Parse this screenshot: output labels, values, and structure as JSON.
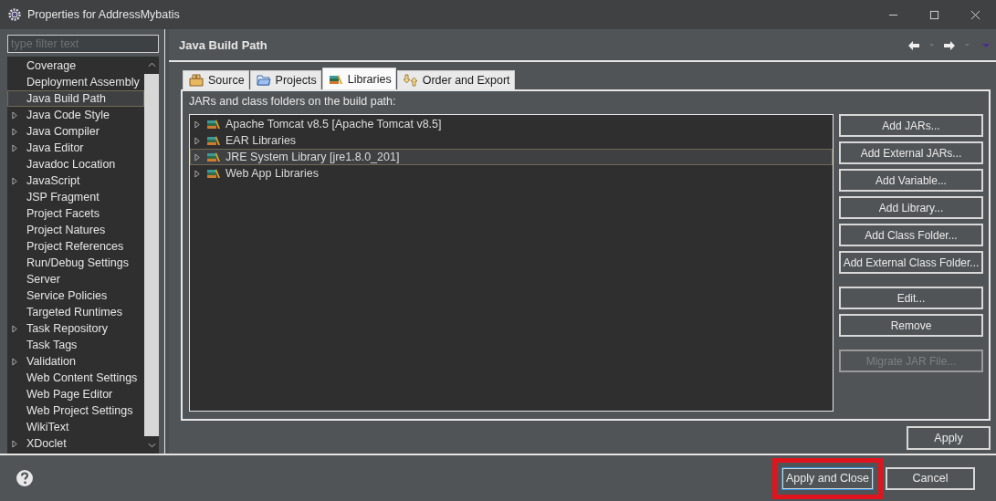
{
  "window": {
    "title": "Properties for AddressMybatis"
  },
  "filter": {
    "placeholder": "type filter text"
  },
  "sidebar": {
    "items": [
      {
        "label": "Coverage",
        "expandable": false,
        "selected": false
      },
      {
        "label": "Deployment Assembly",
        "expandable": false,
        "selected": false
      },
      {
        "label": "Java Build Path",
        "expandable": false,
        "selected": true
      },
      {
        "label": "Java Code Style",
        "expandable": true,
        "selected": false
      },
      {
        "label": "Java Compiler",
        "expandable": true,
        "selected": false
      },
      {
        "label": "Java Editor",
        "expandable": true,
        "selected": false
      },
      {
        "label": "Javadoc Location",
        "expandable": false,
        "selected": false
      },
      {
        "label": "JavaScript",
        "expandable": true,
        "selected": false
      },
      {
        "label": "JSP Fragment",
        "expandable": false,
        "selected": false
      },
      {
        "label": "Project Facets",
        "expandable": false,
        "selected": false
      },
      {
        "label": "Project Natures",
        "expandable": false,
        "selected": false
      },
      {
        "label": "Project References",
        "expandable": false,
        "selected": false
      },
      {
        "label": "Run/Debug Settings",
        "expandable": false,
        "selected": false
      },
      {
        "label": "Server",
        "expandable": false,
        "selected": false
      },
      {
        "label": "Service Policies",
        "expandable": false,
        "selected": false
      },
      {
        "label": "Targeted Runtimes",
        "expandable": false,
        "selected": false
      },
      {
        "label": "Task Repository",
        "expandable": true,
        "selected": false
      },
      {
        "label": "Task Tags",
        "expandable": false,
        "selected": false
      },
      {
        "label": "Validation",
        "expandable": true,
        "selected": false
      },
      {
        "label": "Web Content Settings",
        "expandable": false,
        "selected": false
      },
      {
        "label": "Web Page Editor",
        "expandable": false,
        "selected": false
      },
      {
        "label": "Web Project Settings",
        "expandable": false,
        "selected": false
      },
      {
        "label": "WikiText",
        "expandable": false,
        "selected": false
      },
      {
        "label": "XDoclet",
        "expandable": true,
        "selected": false
      }
    ]
  },
  "page": {
    "title": "Java Build Path"
  },
  "tabs": [
    {
      "label": "Source",
      "kind": "source",
      "selected": false
    },
    {
      "label": "Projects",
      "kind": "projects",
      "selected": false
    },
    {
      "label": "Libraries",
      "kind": "libraries",
      "selected": true
    },
    {
      "label": "Order and Export",
      "kind": "order",
      "selected": false
    }
  ],
  "description": "JARs and class folders on the build path:",
  "libraries": [
    {
      "label": "Apache Tomcat v8.5 [Apache Tomcat v8.5]",
      "selected": false
    },
    {
      "label": "EAR Libraries",
      "selected": false
    },
    {
      "label": "JRE System Library [jre1.8.0_201]",
      "selected": true
    },
    {
      "label": "Web App Libraries",
      "selected": false
    }
  ],
  "button_groups": [
    [
      {
        "label": "Add JARs...",
        "disabled": false
      },
      {
        "label": "Add External JARs...",
        "disabled": false
      },
      {
        "label": "Add Variable...",
        "disabled": false
      },
      {
        "label": "Add Library...",
        "disabled": false
      },
      {
        "label": "Add Class Folder...",
        "disabled": false
      },
      {
        "label": "Add External Class Folder...",
        "disabled": false
      }
    ],
    [
      {
        "label": "Edit...",
        "disabled": false
      },
      {
        "label": "Remove",
        "disabled": false
      }
    ],
    [
      {
        "label": "Migrate JAR File...",
        "disabled": true
      }
    ]
  ],
  "apply": "Apply",
  "footer": [
    {
      "label": "Apply and Close",
      "highlighted": true
    },
    {
      "label": "Cancel",
      "highlighted": false
    }
  ]
}
